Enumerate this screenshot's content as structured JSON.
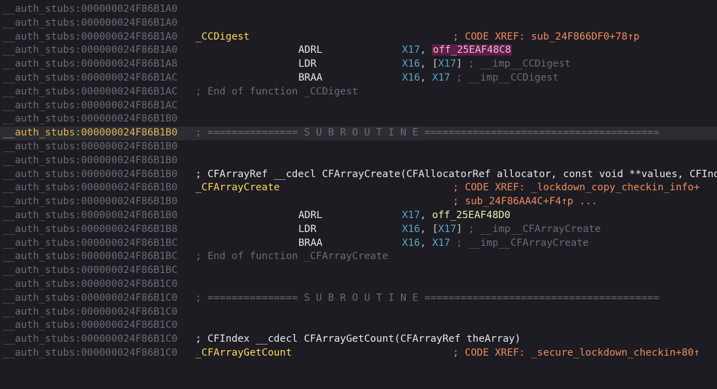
{
  "lines": [
    {
      "addr": "__auth_stubs:000000024F86B1A0"
    },
    {
      "addr": "__auth_stubs:000000024F86B1A0"
    },
    {
      "addr": "__auth_stubs:000000024F86B1A0",
      "label": "_CCDigest",
      "xref": "; CODE XREF: sub_24F866DF0+78↑p"
    },
    {
      "addr": "__auth_stubs:000000024F86B1A0",
      "mnem": "ADRL",
      "reg1": "X17",
      "sep": ", ",
      "ref": "off_25EAF48C8"
    },
    {
      "addr": "__auth_stubs:000000024F86B1A8",
      "mnem": "LDR",
      "reg1": "X16",
      "sep": ", ",
      "bl": "[",
      "reg2": "X17",
      "br": "]",
      "cmt": " ; __imp__CCDigest"
    },
    {
      "addr": "__auth_stubs:000000024F86B1AC",
      "mnem": "BRAA",
      "reg1": "X16",
      "sep": ", ",
      "reg2": "X17",
      "cmt": " ; __imp__CCDigest"
    },
    {
      "addr": "__auth_stubs:000000024F86B1AC",
      "comment": "; End of function _CCDigest"
    },
    {
      "addr": "__auth_stubs:000000024F86B1AC"
    },
    {
      "addr": "__auth_stubs:000000024F86B1B0"
    },
    {
      "addr": "__auth_stubs:000000024F86B1B0",
      "comment": "; =============== S U B R O U T I N E =======================================",
      "current": true
    },
    {
      "addr": "__auth_stubs:000000024F86B1B0"
    },
    {
      "addr": "__auth_stubs:000000024F86B1B0"
    },
    {
      "addr": "__auth_stubs:000000024F86B1B0",
      "proto": "; CFArrayRef __cdecl CFArrayCreate(CFAllocatorRef allocator, const void **values, CFIndex numValues, const CFArrayCallBacks *callBacks)"
    },
    {
      "addr": "__auth_stubs:000000024F86B1B0",
      "label": "_CFArrayCreate",
      "xref": "; CODE XREF: _lockdown_copy_checkin_info+"
    },
    {
      "addr": "__auth_stubs:000000024F86B1B0",
      "xref": "; sub_24F86AA4C+F4↑p ..."
    },
    {
      "addr": "__auth_stubs:000000024F86B1B0",
      "mnem": "ADRL",
      "reg1": "X17",
      "sep": ", ",
      "ref2": "off_25EAF48D0"
    },
    {
      "addr": "__auth_stubs:000000024F86B1B8",
      "mnem": "LDR",
      "reg1": "X16",
      "sep": ", ",
      "bl": "[",
      "reg2": "X17",
      "br": "]",
      "cmt": " ; __imp__CFArrayCreate"
    },
    {
      "addr": "__auth_stubs:000000024F86B1BC",
      "mnem": "BRAA",
      "reg1": "X16",
      "sep": ", ",
      "reg2": "X17",
      "cmt": " ; __imp__CFArrayCreate"
    },
    {
      "addr": "__auth_stubs:000000024F86B1BC",
      "comment": "; End of function _CFArrayCreate"
    },
    {
      "addr": "__auth_stubs:000000024F86B1BC"
    },
    {
      "addr": "__auth_stubs:000000024F86B1C0"
    },
    {
      "addr": "__auth_stubs:000000024F86B1C0",
      "comment": "; =============== S U B R O U T I N E ======================================="
    },
    {
      "addr": "__auth_stubs:000000024F86B1C0"
    },
    {
      "addr": "__auth_stubs:000000024F86B1C0"
    },
    {
      "addr": "__auth_stubs:000000024F86B1C0",
      "proto": "; CFIndex __cdecl CFArrayGetCount(CFArrayRef theArray)"
    },
    {
      "addr": "__auth_stubs:000000024F86B1C0",
      "label": "_CFArrayGetCount",
      "xref": "; CODE XREF: _secure_lockdown_checkin+80↑"
    }
  ],
  "colors": {
    "background": "#1c1c22",
    "address": "#6b6b75",
    "address_current": "#e6b450",
    "label": "#ffd75f",
    "xref": "#f08a5d",
    "register": "#5aa5c8",
    "highlight_ref_bg": "#5a1f4a"
  }
}
